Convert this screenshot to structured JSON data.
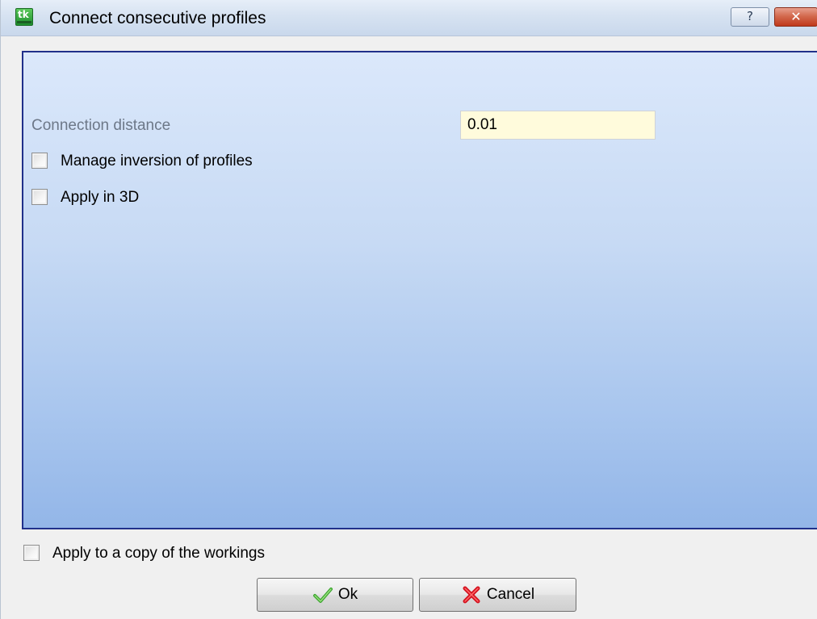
{
  "window": {
    "title": "Connect consecutive profiles",
    "help_glyph": "?",
    "close_glyph": "✕"
  },
  "app_icon": {
    "name": "app-icon",
    "glyph": "tk"
  },
  "form": {
    "connection_distance": {
      "label": "Connection distance",
      "value": "0.01"
    },
    "manage_inversion": {
      "label": "Manage inversion of profiles",
      "checked": false
    },
    "apply_3d": {
      "label": "Apply in 3D",
      "checked": false
    }
  },
  "footer": {
    "apply_copy": {
      "label": "Apply to a copy of the workings",
      "checked": false
    },
    "ok_label": "Ok",
    "cancel_label": "Cancel"
  },
  "icons": {
    "ok": "checkmark-icon",
    "cancel": "red-x-icon"
  },
  "colors": {
    "panel_border": "#20308a",
    "input_background": "#fffbdc",
    "check_green": "#3aa52e",
    "cancel_red": "#d4101e"
  }
}
